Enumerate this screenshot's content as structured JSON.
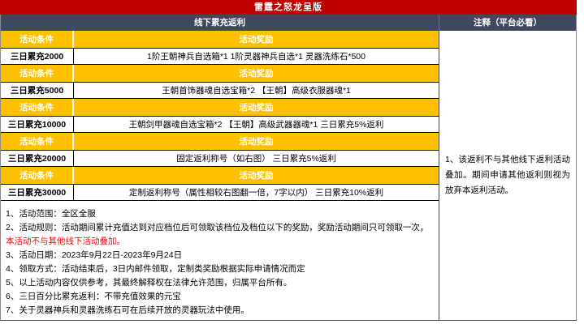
{
  "title": "雷霆之怒龙呈版",
  "colors": {
    "title_bar": "#c00000",
    "section_header": "#3e4960",
    "tier_header": "#ffc000",
    "highlight_text": "#ff0000"
  },
  "left": {
    "header": "线下累充返利",
    "col_condition": "活动条件",
    "col_reward": "活动奖励",
    "tiers": [
      {
        "condition": "三日累充2000",
        "reward": "1阶王朝神兵自选箱*1 1阶灵器神兵自选*1 灵器洗练石*500"
      },
      {
        "condition": "三日累充5000",
        "reward": "王朝首饰器魂自选宝箱*2 【王朝】高级衣服器魂*1"
      },
      {
        "condition": "三日累充10000",
        "reward": "王朝剑甲器魂自选宝箱*2 【王朝】高级武器器魂*1 三日累充5%返利"
      },
      {
        "condition": "三日累充20000",
        "reward": "固定返利称号（如右图） 三日累充5%返利"
      },
      {
        "condition": "三日累充30000",
        "reward": "定制返利称号（属性相较右图翻一倍，7字以内） 三日累充10%返利"
      }
    ],
    "notes": [
      {
        "text": "1、活动范围：全区全服"
      },
      {
        "text": "2、活动规则：活动期间累计充值达到对应档位后可领取该档位及档位以下的奖励，奖励活动期间只可领取一次，",
        "highlight": "本活动不与其他线下活动叠加。"
      },
      {
        "text": "3、活动日期：2023年9月22日-2023年9月24日"
      },
      {
        "text": "4、领取方式：活动结束后，3日内邮件领取，定制类奖励根据实际申请情况而定"
      },
      {
        "text": "5、以上活动内容仅供参考，其最终解释权在法律允许范围，归属平台所有。"
      },
      {
        "text": "6、三日百分比累充返利：不带充值效果的元宝"
      },
      {
        "text": "7、关于灵器神兵和灵器洗练石可在后续开放的灵器玩法中使用。"
      }
    ]
  },
  "right": {
    "header": "注释（平台必看）",
    "note": "1、该返利不与其他线下返利活动叠加。期间申请其他返利则视为放弃本返利活动。"
  }
}
